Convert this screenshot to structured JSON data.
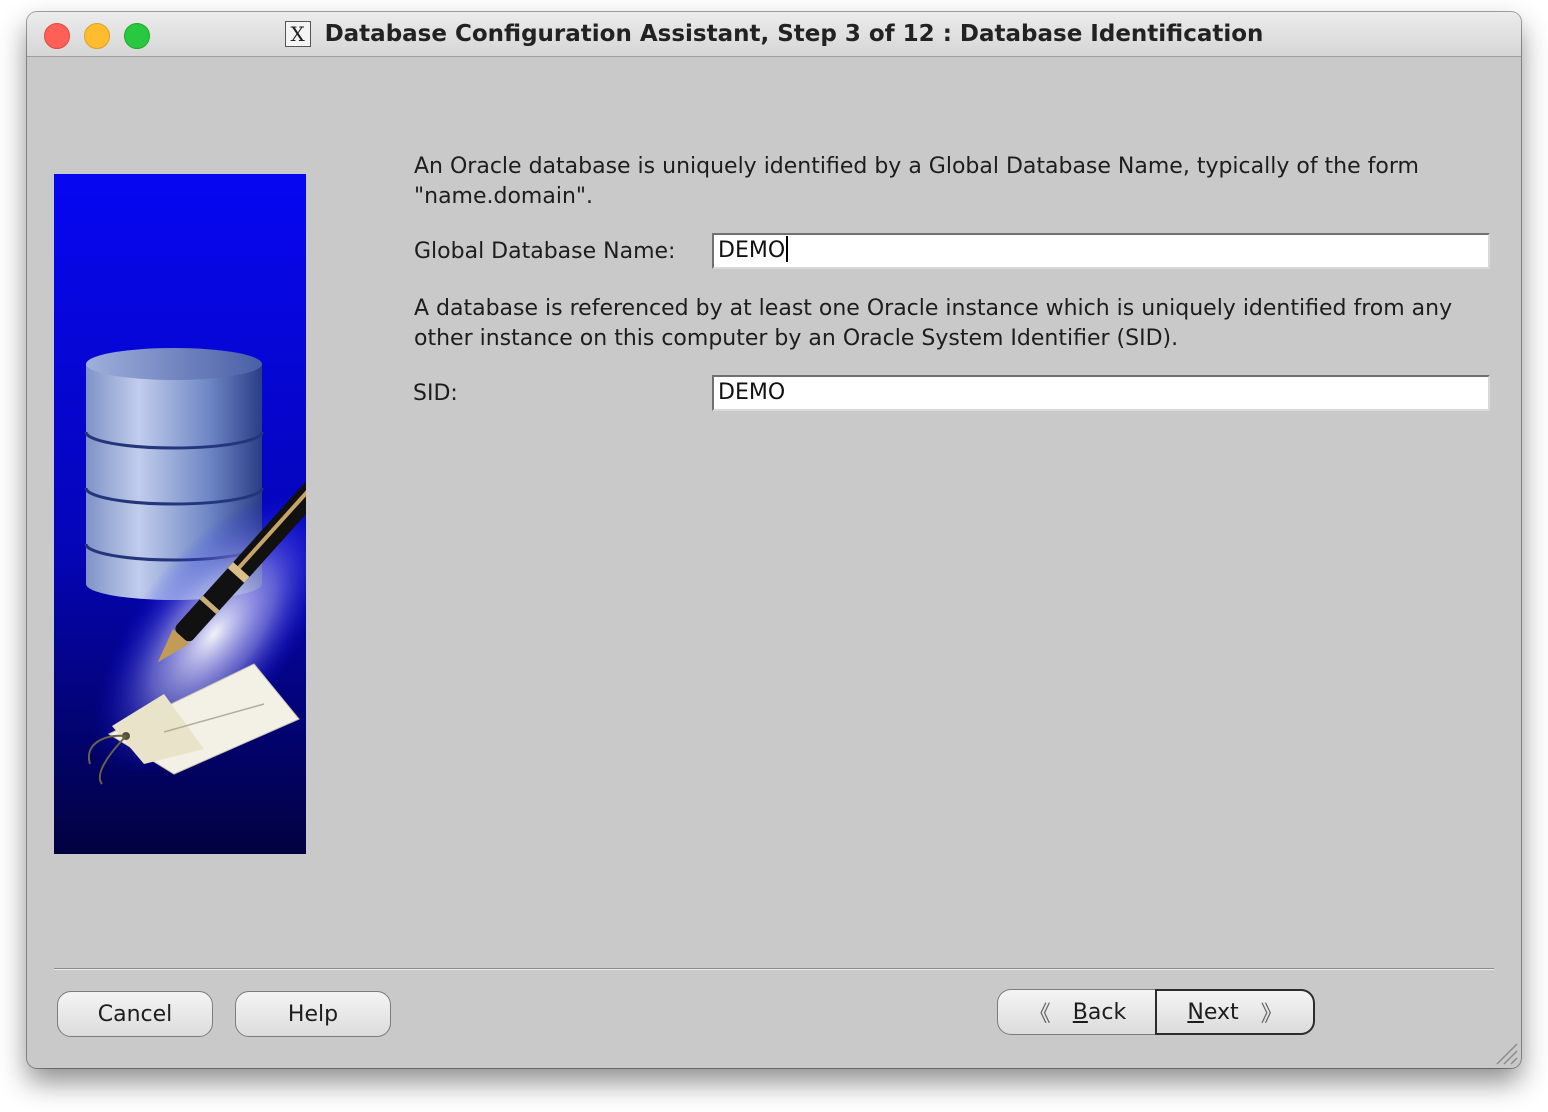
{
  "window": {
    "title": "Database Configuration Assistant, Step 3 of 12 : Database Identification",
    "app_icon": "X"
  },
  "content": {
    "intro_text": "An Oracle database is uniquely identified by a Global Database Name, typically of the form \"name.domain\".",
    "global_db_label": "Global Database Name:",
    "global_db_value": "DEMO",
    "sid_intro_text": "A database is referenced by at least one Oracle instance which is uniquely identified from any other instance on this computer by an Oracle System Identifier (SID).",
    "sid_label": "SID:",
    "sid_value": "DEMO"
  },
  "buttons": {
    "cancel": "Cancel",
    "help": "Help",
    "back_mnemonic": "B",
    "back_rest": "ack",
    "next_mnemonic": "N",
    "next_rest": "ext"
  },
  "colors": {
    "panel_bg": "#c9c9c9",
    "image_blue": "#0a0af0"
  },
  "icons": [
    "x11-app-icon",
    "database-cylinder-image",
    "pen-icon",
    "tag-icon",
    "back-arrow-icon",
    "next-arrow-icon",
    "resize-grip-icon"
  ]
}
